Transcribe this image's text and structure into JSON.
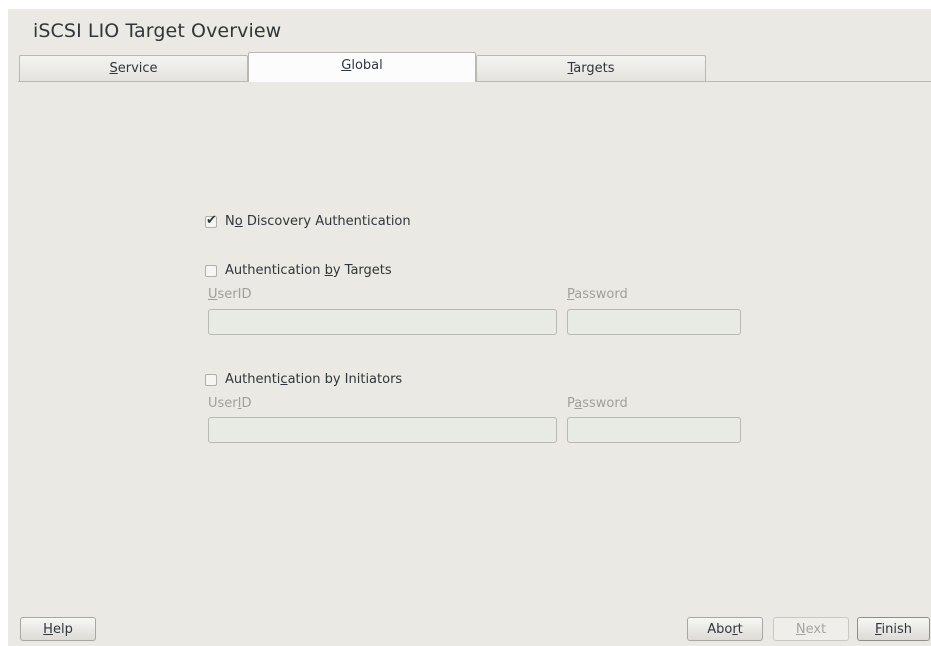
{
  "window": {
    "title": "iSCSI LIO Target Overview"
  },
  "tabs": [
    {
      "pre": "",
      "key": "S",
      "post": "ervice",
      "active": false
    },
    {
      "pre": "",
      "key": "G",
      "post": "lobal",
      "active": true
    },
    {
      "pre": "",
      "key": "T",
      "post": "argets",
      "active": false
    }
  ],
  "no_discovery_auth": {
    "pre": "N",
    "key": "o",
    "post": " Discovery Authentication",
    "checked": true
  },
  "auth_by_targets": {
    "pre": "Authentication ",
    "key": "b",
    "post": "y Targets",
    "checked": false,
    "userid_label": {
      "pre": "",
      "key": "U",
      "post": "serID"
    },
    "password_label": {
      "pre": "",
      "key": "P",
      "post": "assword"
    },
    "userid_value": "",
    "password_value": ""
  },
  "auth_by_initiators": {
    "pre": "Authenti",
    "key": "c",
    "post": "ation by Initiators",
    "checked": false,
    "userid_label": {
      "pre": "User",
      "key": "I",
      "post": "D"
    },
    "password_label": {
      "pre": "P",
      "key": "a",
      "post": "ssword"
    },
    "userid_value": "",
    "password_value": ""
  },
  "buttons": {
    "help": {
      "pre": "",
      "key": "H",
      "post": "elp"
    },
    "abort": {
      "pre": "Abo",
      "key": "r",
      "post": "t"
    },
    "next": {
      "pre": "",
      "key": "N",
      "post": "ext",
      "disabled": true
    },
    "finish": {
      "pre": "",
      "key": "F",
      "post": "inish"
    }
  }
}
